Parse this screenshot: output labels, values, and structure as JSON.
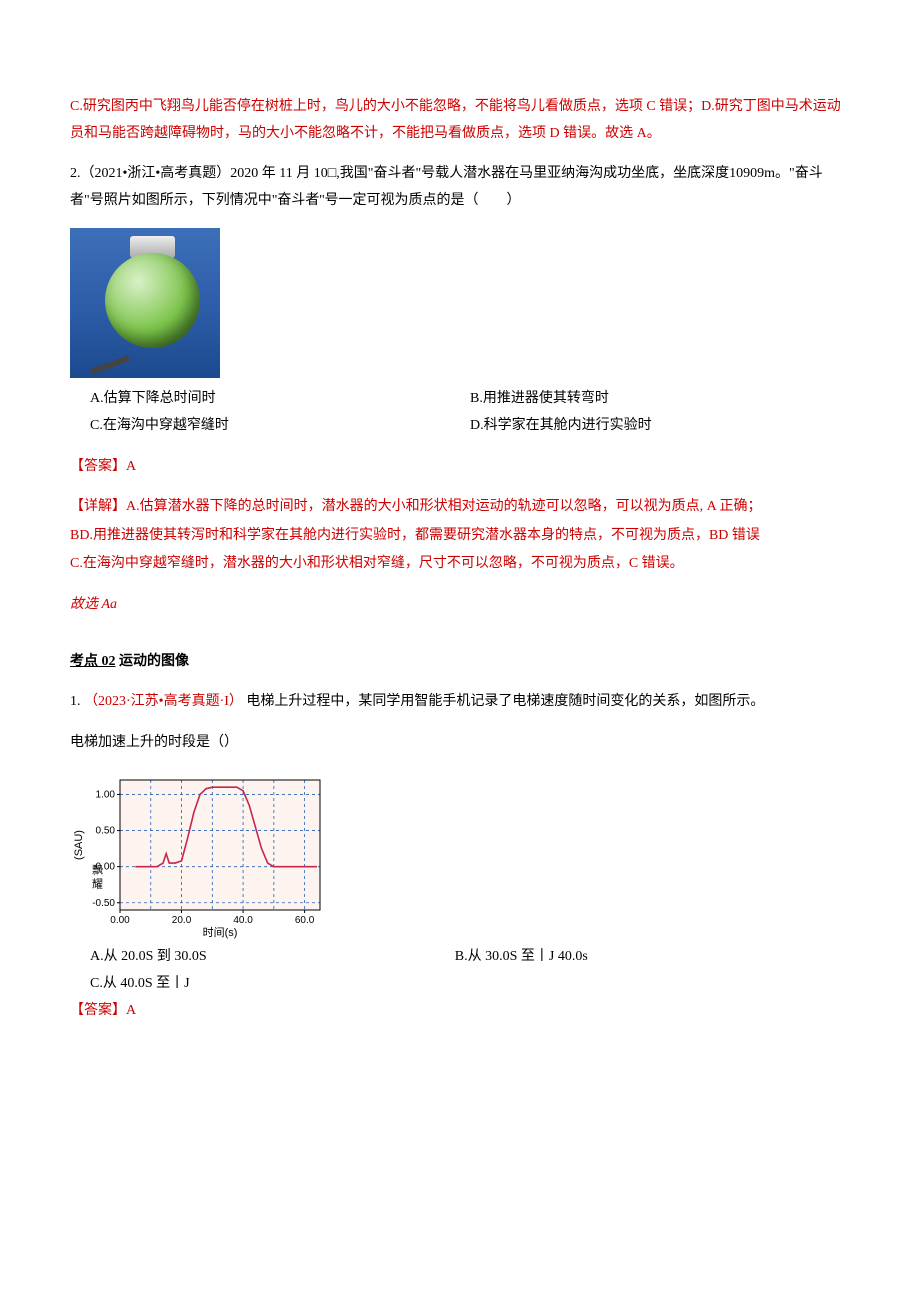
{
  "intro_red_c": "C.研究图丙中飞翔鸟儿能否停在树桩上时，鸟儿的大小不能忽略，不能将鸟儿看做质点，选项 C 错误；D.研究丁图中马术运动员和马能否跨越障碍物时，马的大小不能忽略不计，不能把马看做质点，选项 D 错误。故选 A。",
  "q2": {
    "stem": "2.（2021•浙江•高考真题）2020 年 11 月 10□,我国\"奋斗者\"号载人潜水器在马里亚纳海沟成功坐底，坐底深度10909m。\"奋斗者\"号照片如图所示，下列情况中\"奋斗者''号一定可视为质点的是（　　）",
    "A": "A.估算下降总时间时",
    "B": "B.用推进器使其转弯时",
    "C": "C.在海沟中穿越窄缝时",
    "D": "D.科学家在其舱内进行实验时",
    "ans_label": "【答案】A",
    "detail_label": "【详解】A.估算潜水器下降的总时间时，潜水器的大小和形状相对运动的轨迹可以忽略，可以视为质点, A 正确；",
    "detail_bd": "BD.用推进器使其转泻时和科学家在其舱内进行实验时，都需要研究潜水器本身的特点，不可视为质点，BD 错误",
    "detail_c": "C.在海沟中穿越窄缝时，潜水器的大小和形状相对窄缝，尺寸不可以忽略，不可视为质点，C 错误。",
    "pick": "故选 Aa"
  },
  "sec02": {
    "prefix": "考点",
    "num": "02",
    "title": "运动的图像"
  },
  "q3": {
    "num": "1.",
    "src": "（2023·江苏•高考真题·I）",
    "stem": "电梯上升过程中，某同学用智能手机记录了电梯速度随时间变化的关系，如图所示。",
    "stem2": "电梯加速上升的时段是（）",
    "A": "A.从 20.0S 到 30.0S",
    "B": "B.从 30.0S 至丨J 40.0s",
    "C": "C.从 40.0S 至丨J",
    "ans": "【答案】A"
  },
  "chart_data": {
    "type": "line",
    "title": "",
    "xlabel": "时间(s)",
    "ylabel": "飘耀 (SAU)",
    "xlim": [
      0,
      65
    ],
    "ylim": [
      -0.6,
      1.2
    ],
    "xticks": [
      0.0,
      20.0,
      40.0,
      60.0
    ],
    "yticks": [
      -0.5,
      0.0,
      0.5,
      1.0
    ],
    "grid_x": [
      10,
      20,
      30,
      40,
      50,
      60
    ],
    "series": [
      {
        "name": "v",
        "color": "#c6264a",
        "points": [
          [
            5,
            0.0
          ],
          [
            12,
            0.0
          ],
          [
            14,
            0.05
          ],
          [
            15,
            0.18
          ],
          [
            16,
            0.05
          ],
          [
            18,
            0.05
          ],
          [
            20,
            0.08
          ],
          [
            22,
            0.4
          ],
          [
            24,
            0.75
          ],
          [
            26,
            1.0
          ],
          [
            28,
            1.08
          ],
          [
            30,
            1.1
          ],
          [
            34,
            1.1
          ],
          [
            38,
            1.1
          ],
          [
            40,
            1.05
          ],
          [
            42,
            0.85
          ],
          [
            44,
            0.55
          ],
          [
            46,
            0.25
          ],
          [
            48,
            0.05
          ],
          [
            50,
            0.0
          ],
          [
            60,
            0.0
          ],
          [
            64,
            0.0
          ]
        ]
      }
    ]
  }
}
